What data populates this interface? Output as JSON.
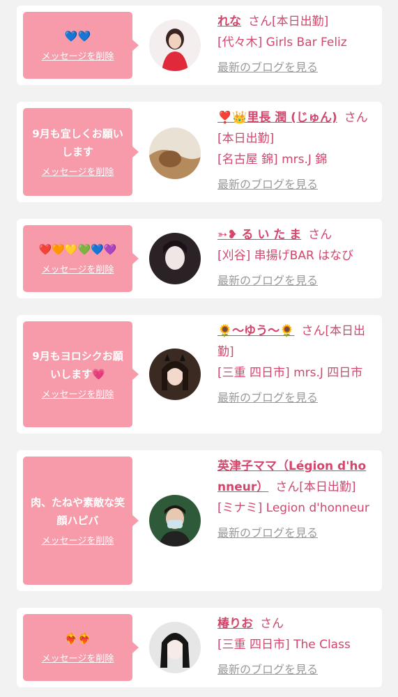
{
  "delete_label": "メッセージを削除",
  "blog_label": "最新のブログを見る",
  "cards": [
    {
      "message": "💙💙",
      "name": "れな",
      "suffix": "さん[本日出勤]",
      "shop": "[代々木] Girls Bar Feliz"
    },
    {
      "message": "9月も宜しくお願いします",
      "name": "❣️👑里長 潤 (じゅん)",
      "suffix": "さん[本日出勤]",
      "shop": "[名古屋 錦] mrs.J 錦"
    },
    {
      "message": "❤️🧡💛💚💙💜",
      "name": "➳❥ る い た ま",
      "suffix": "さん",
      "shop": "[刈谷] 串揚げBAR はなび"
    },
    {
      "message": "9月もヨロシクお願いします💗",
      "name": "🌻〜ゆう〜🌻",
      "suffix": "さん[本日出勤]",
      "shop": "[三重 四日市] mrs.J 四日市"
    },
    {
      "message": "肉、たねや素敵な笑顔ハピバ",
      "name": "英津子ママ（Légion d'honneur）",
      "suffix": "さん[本日出勤]",
      "shop": "[ミナミ] Legion d'honneur"
    },
    {
      "message": "❤️‍🔥❤️‍🔥",
      "name": "椿りお",
      "suffix": "さん",
      "shop": "[三重 四日市] The Class"
    }
  ],
  "colors": {
    "accent": "#d4456b",
    "bubble": "#f79bab",
    "muted": "#999999",
    "background": "#f2f2f2"
  }
}
